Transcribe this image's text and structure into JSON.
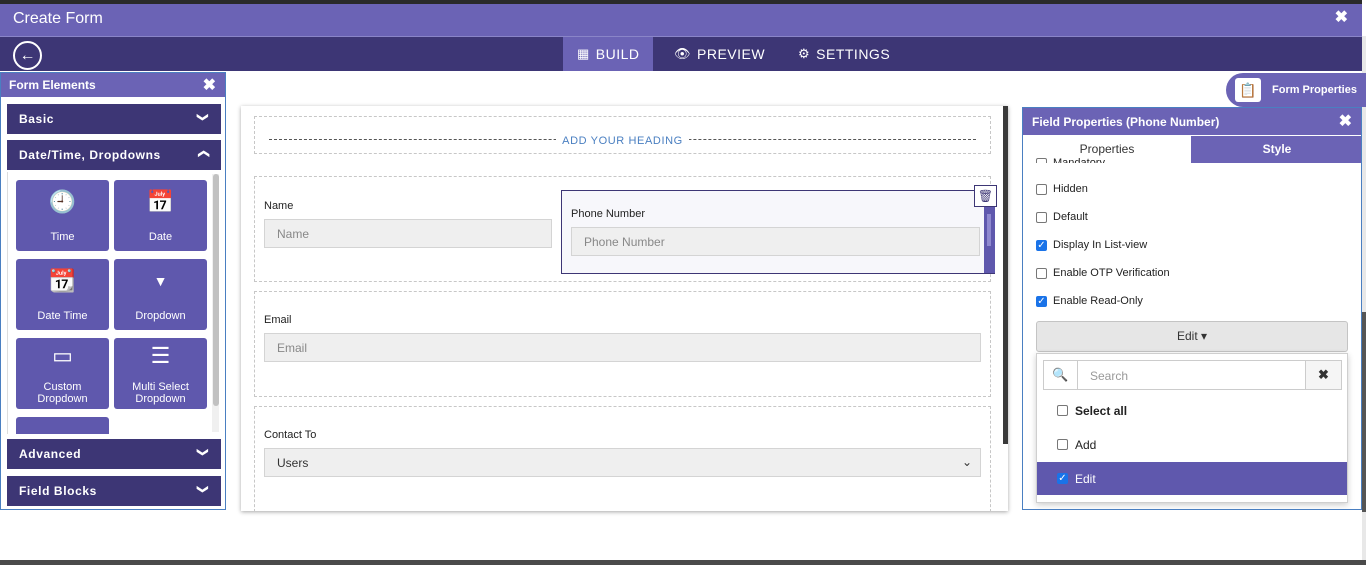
{
  "window": {
    "title": "Create Form",
    "close_icon": "✖"
  },
  "nav": {
    "back_icon": "←",
    "tabs": [
      {
        "label": "BUILD",
        "icon": "▦"
      },
      {
        "label": "PREVIEW",
        "icon": "👁"
      },
      {
        "label": "SETTINGS",
        "icon": "⚙"
      }
    ]
  },
  "left_panel": {
    "title": "Form Elements",
    "close_icon": "✖",
    "sections": [
      {
        "label": "Basic",
        "chevron": "❯"
      },
      {
        "label": "Date/Time,  Dropdowns",
        "chevron": "❯"
      },
      {
        "label": "Advanced",
        "chevron": "❯"
      },
      {
        "label": "Field  Blocks",
        "chevron": "❯"
      }
    ],
    "tiles": [
      {
        "label": "Time",
        "icon": "🕘"
      },
      {
        "label": "Date",
        "icon": "📅"
      },
      {
        "label": "Date Time",
        "icon": "📆"
      },
      {
        "label": "Dropdown",
        "icon": "▼"
      },
      {
        "label": "Custom\nDropdown",
        "icon": "▭"
      },
      {
        "label": "Multi Select\nDropdown",
        "icon": "☰"
      }
    ]
  },
  "canvas": {
    "heading": "ADD YOUR HEADING",
    "fields": {
      "name": {
        "label": "Name",
        "placeholder": "Name"
      },
      "phone": {
        "label": "Phone Number",
        "placeholder": "Phone Number"
      },
      "email": {
        "label": "Email",
        "placeholder": "Email"
      },
      "contact": {
        "label": "Contact To",
        "value": "Users"
      }
    },
    "delete_icon": "🗑"
  },
  "form_properties": {
    "label": "Form Properties",
    "icon": "📋"
  },
  "right_panel": {
    "title": "Field Properties (Phone Number)",
    "close_icon": "✖",
    "tabs": {
      "properties": "Properties",
      "style": "Style"
    },
    "partial_option": "Mandatory",
    "options": [
      {
        "label": "Hidden",
        "checked": false
      },
      {
        "label": "Default",
        "checked": false
      },
      {
        "label": "Display In List-view",
        "checked": true
      },
      {
        "label": "Enable OTP Verification",
        "checked": false
      },
      {
        "label": "Enable Read-Only",
        "checked": true
      }
    ],
    "dropdown_button": "Edit ▾",
    "dropdown": {
      "search_placeholder": "Search",
      "search_icon": "🔍",
      "clear_icon": "✖",
      "items": [
        {
          "label": "Select all",
          "checked": false,
          "bold": true
        },
        {
          "label": "Add",
          "checked": false
        },
        {
          "label": "Edit",
          "checked": true,
          "selected": true
        }
      ]
    }
  }
}
